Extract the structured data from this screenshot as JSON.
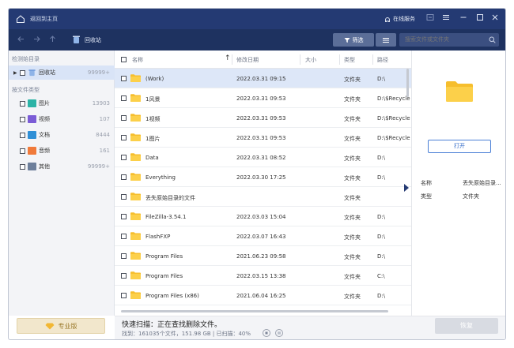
{
  "titlebar": {
    "back_home": "返回到主页",
    "service": "在线服务",
    "colors": {
      "bar": "#243a73"
    }
  },
  "toolbar": {
    "crumb": "回收站",
    "filter_label": "筛选",
    "search_placeholder": "搜索文件或文件夹"
  },
  "sidebar": {
    "section_location": "检测始目录",
    "location_item": {
      "label": "回收站",
      "count": "99999+"
    },
    "section_types": "按文件类型",
    "types": [
      {
        "label": "图片",
        "count": "13903",
        "icon": "image-icon",
        "color": "#2bb3a6"
      },
      {
        "label": "视频",
        "count": "107",
        "icon": "video-icon",
        "color": "#7b5cd6"
      },
      {
        "label": "文档",
        "count": "8444",
        "icon": "document-icon",
        "color": "#2f8fd6"
      },
      {
        "label": "音频",
        "count": "161",
        "icon": "audio-icon",
        "color": "#f07a3a"
      },
      {
        "label": "其他",
        "count": "99999+",
        "icon": "other-icon",
        "color": "#6d7f9b"
      }
    ],
    "pro_label": "专业版"
  },
  "table": {
    "headers": {
      "name": "名称",
      "date": "修改日期",
      "size": "大小",
      "type": "类型",
      "path": "路径"
    },
    "rows": [
      {
        "name": "(Work)",
        "date": "2022.03.31 09:15",
        "type": "文件夹",
        "path": "D:\\"
      },
      {
        "name": "1风景",
        "date": "2022.03.31 09:53",
        "type": "文件夹",
        "path": "D:\\$Recycle Bin"
      },
      {
        "name": "1视频",
        "date": "2022.03.31 09:53",
        "type": "文件夹",
        "path": "D:\\$Recycle Bin"
      },
      {
        "name": "1图片",
        "date": "2022.03.31 09:53",
        "type": "文件夹",
        "path": "D:\\$Recycle Bin"
      },
      {
        "name": "Data",
        "date": "2022.03.31 08:52",
        "type": "文件夹",
        "path": "D:\\"
      },
      {
        "name": "Everything",
        "date": "2022.03.30 17:25",
        "type": "文件夹",
        "path": "D:\\"
      },
      {
        "name": "丢失原始目录的文件",
        "date": "",
        "type": "文件夹",
        "path": ""
      },
      {
        "name": "FileZilla-3.54.1",
        "date": "2022.03.03 15:04",
        "type": "文件夹",
        "path": "D:\\"
      },
      {
        "name": "FlashFXP",
        "date": "2022.03.07 16:43",
        "type": "文件夹",
        "path": "D:\\"
      },
      {
        "name": "Program Files",
        "date": "2021.06.23 09:58",
        "type": "文件夹",
        "path": "D:\\"
      },
      {
        "name": "Program Files",
        "date": "2022.03.15 13:38",
        "type": "文件夹",
        "path": "C:\\"
      },
      {
        "name": "Program Files (x86)",
        "date": "2021.06.04 16:25",
        "type": "文件夹",
        "path": "D:\\"
      }
    ],
    "selected_index": 0
  },
  "detail": {
    "open_label": "打开",
    "name_key": "名称",
    "name_value": "丢失原始目录...",
    "type_key": "类型",
    "type_value": "文件夹"
  },
  "status": {
    "title": "快速扫描：正在查找删除文件。",
    "stats": "找到：161035个文件，151.98 GB | 已扫描：40%",
    "progress_percent": 40,
    "recover_label": "恢复"
  }
}
